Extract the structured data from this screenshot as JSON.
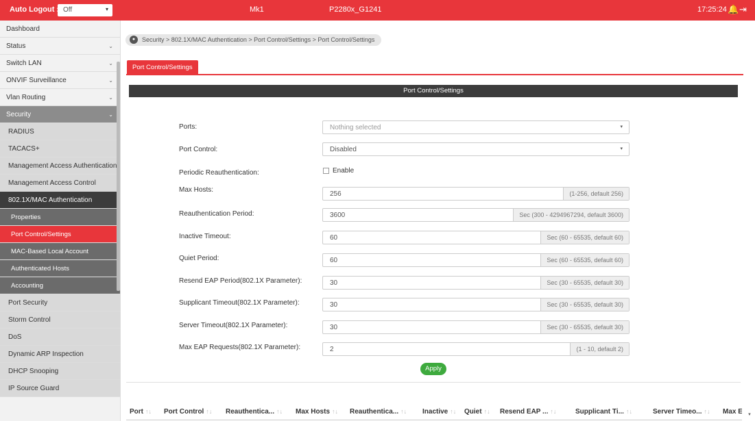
{
  "header": {
    "auto_logout_label": "Auto Logout :",
    "auto_logout_value": "Off",
    "model": "Mk1",
    "firmware": "P2280x_G1241",
    "time": "17:25:24",
    "bell_icon": "🔔",
    "exit_icon": "⇥",
    "caret": "▾"
  },
  "sidebar": {
    "chevron": "⌄",
    "items": [
      {
        "label": "Dashboard"
      },
      {
        "label": "Status"
      },
      {
        "label": "Switch LAN"
      },
      {
        "label": "ONVIF Surveillance"
      },
      {
        "label": "Vlan Routing"
      },
      {
        "label": "Security"
      },
      {
        "label": "RADIUS"
      },
      {
        "label": "TACACS+"
      },
      {
        "label": "Management Access Authentication"
      },
      {
        "label": "Management Access Control"
      },
      {
        "label": "802.1X/MAC Authentication"
      },
      {
        "label": "Properties"
      },
      {
        "label": "Port Control/Settings"
      },
      {
        "label": "MAC-Based Local Account"
      },
      {
        "label": "Authenticated Hosts"
      },
      {
        "label": "Accounting"
      },
      {
        "label": "Port Security"
      },
      {
        "label": "Storm Control"
      },
      {
        "label": "DoS"
      },
      {
        "label": "Dynamic ARP Inspection"
      },
      {
        "label": "DHCP Snooping"
      },
      {
        "label": "IP Source Guard"
      }
    ]
  },
  "breadcrumb": "Security > 802.1X/MAC Authentication > Port Control/Settings > Port Control/Settings",
  "tab_label": "Port Control/Settings",
  "panel_title": "Port Control/Settings",
  "form": {
    "ports_label": "Ports:",
    "ports_placeholder": "Nothing selected",
    "port_control_label": "Port Control:",
    "port_control_value": "Disabled",
    "periodic_label": "Periodic Reauthentication:",
    "periodic_checkbox_label": "Enable",
    "max_hosts_label": "Max Hosts:",
    "max_hosts_value": "256",
    "max_hosts_hint": "(1-256, default 256)",
    "reauth_period_label": "Reauthentication Period:",
    "reauth_period_value": "3600",
    "reauth_period_hint": "Sec (300 - 4294967294, default 3600)",
    "inactive_label": "Inactive Timeout:",
    "inactive_value": "60",
    "inactive_hint": "Sec (60 - 65535, default 60)",
    "quiet_label": "Quiet Period:",
    "quiet_value": "60",
    "quiet_hint": "Sec (60 - 65535, default 60)",
    "resend_label": "Resend EAP Period(802.1X Parameter):",
    "resend_value": "30",
    "resend_hint": "Sec (30 - 65535, default 30)",
    "supplicant_label": "Supplicant Timeout(802.1X Parameter):",
    "supplicant_value": "30",
    "supplicant_hint": "Sec (30 - 65535, default 30)",
    "server_label": "Server Timeout(802.1X Parameter):",
    "server_value": "30",
    "server_hint": "Sec (30 - 65535, default 30)",
    "max_eap_label": "Max EAP Requests(802.1X Parameter):",
    "max_eap_value": "2",
    "max_eap_hint": "(1 - 10, default 2)",
    "apply_label": "Apply"
  },
  "table": {
    "sort_glyph": "↑↓",
    "columns": [
      "Port",
      "Port Control",
      "Reauthentica...",
      "Max Hosts",
      "Reauthentica...",
      "Inactive",
      "Quiet",
      "Resend EAP ...",
      "Supplicant Ti...",
      "Server Timeo...",
      "Max E"
    ]
  },
  "colors": {
    "accent": "#e8363b",
    "dark": "#3c3c3c",
    "apply": "#3eaa3e"
  }
}
